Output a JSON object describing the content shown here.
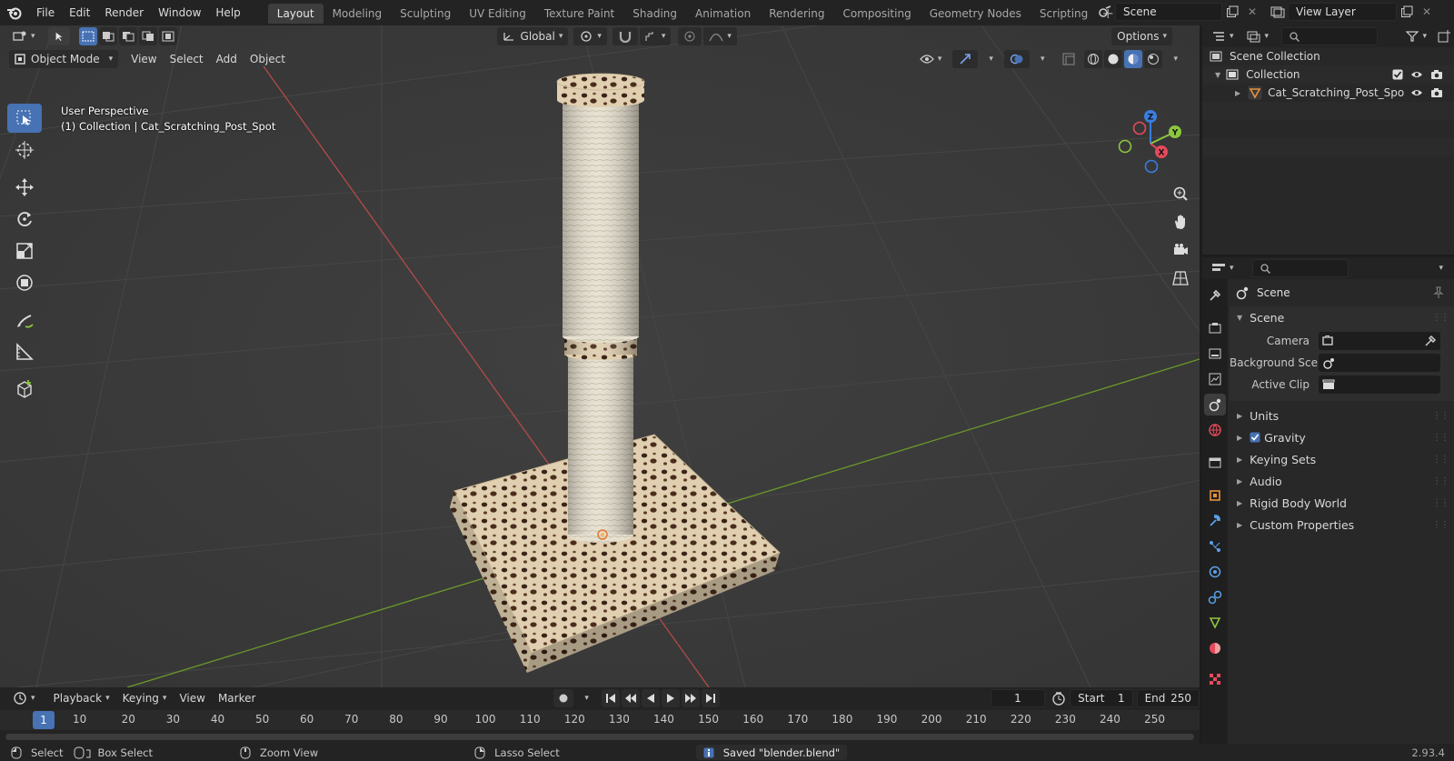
{
  "menubar": {
    "items": [
      "File",
      "Edit",
      "Render",
      "Window",
      "Help"
    ],
    "workspaces": [
      "Layout",
      "Modeling",
      "Sculpting",
      "UV Editing",
      "Texture Paint",
      "Shading",
      "Animation",
      "Rendering",
      "Compositing",
      "Geometry Nodes",
      "Scripting"
    ],
    "active_workspace": "Layout",
    "scene_name": "Scene",
    "view_layer": "View Layer"
  },
  "viewport": {
    "mode": "Object Mode",
    "menus": [
      "View",
      "Select",
      "Add",
      "Object"
    ],
    "orientation": "Global",
    "options_label": "Options",
    "perspective_label": "User Perspective",
    "collection_label": "(1) Collection | Cat_Scratching_Post_Spot"
  },
  "gizmo": {
    "x": "X",
    "y": "Y",
    "z": "Z"
  },
  "outliner": {
    "root": "Scene Collection",
    "collection": "Collection",
    "object": "Cat_Scratching_Post_Spo"
  },
  "properties": {
    "context": "Scene",
    "panel": "Scene",
    "fields": [
      {
        "label": "Camera"
      },
      {
        "label": "Background Sce..."
      },
      {
        "label": "Active Clip"
      }
    ],
    "subpanels": [
      "Units",
      "Gravity",
      "Keying Sets",
      "Audio",
      "Rigid Body World",
      "Custom Properties"
    ]
  },
  "timeline": {
    "menus": [
      "Playback",
      "Keying",
      "View",
      "Marker"
    ],
    "current_frame": "1",
    "start_label": "Start",
    "start": "1",
    "end_label": "End",
    "end": "250",
    "ticks": [
      "1",
      "10",
      "20",
      "30",
      "40",
      "50",
      "60",
      "70",
      "80",
      "90",
      "100",
      "110",
      "120",
      "130",
      "140",
      "150",
      "160",
      "170",
      "180",
      "190",
      "200",
      "210",
      "220",
      "230",
      "240",
      "250"
    ]
  },
  "statusbar": {
    "select": "Select",
    "box_select": "Box Select",
    "zoom_view": "Zoom View",
    "lasso_select": "Lasso Select",
    "message": "Saved \"blender.blend\"",
    "version": "2.93.4"
  },
  "colors": {
    "accent": "#4772b3",
    "x_axis": "#e54a5a",
    "y_axis": "#8cc63f",
    "z_axis": "#3a7ee0"
  }
}
